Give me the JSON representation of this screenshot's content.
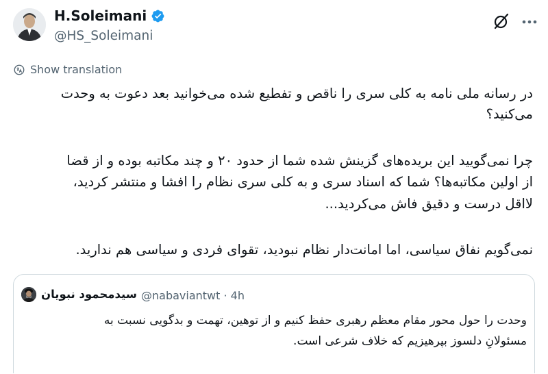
{
  "author": {
    "display_name": "H.Soleimani",
    "handle": "@HS_Soleimani",
    "verified_badge_icon": "verified-badge-icon",
    "badge_color": "#1d9bf0"
  },
  "header_actions": {
    "grok_icon": "grok-slash-icon",
    "more_icon": "more-dots-icon"
  },
  "translation": {
    "icon": "translate-icon",
    "label": "Show translation"
  },
  "tweet": {
    "lines": [
      "در رسانه ملی نامه به کلی سری را ناقص و تفطیع شده می‌خوانید بعد دعوت به وحدت",
      "می‌کنید؟",
      "چرا نمی‌گویید این بریده‌های گزینش شده شما از حدود ۲۰ و چند مکاتبه بوده و از قضا",
      "از اولین مکاتبه‌ها؟ شما که اسناد سری و به کلی سری نظام را افشا و منتشر کردید،",
      "لااقل درست و دقیق فاش می‌کردید...",
      "نمی‌گویم نفاق سیاسی، اما امانت‌دار نظام نبودید، تقوای فردی و سیاسی هم ندارید."
    ]
  },
  "quoted_tweet": {
    "display_name": "سیدمحمود نبویان",
    "handle_time": "@nabaviantwt · 4h",
    "lines": [
      "وحدت را حول محور مقام معظم رهبری حفظ کنیم و از توهین، تهمت و بدگویی نسبت به",
      "مسئولانِ دلسوز بپرهیزیم که خلاف شرعی است."
    ]
  }
}
